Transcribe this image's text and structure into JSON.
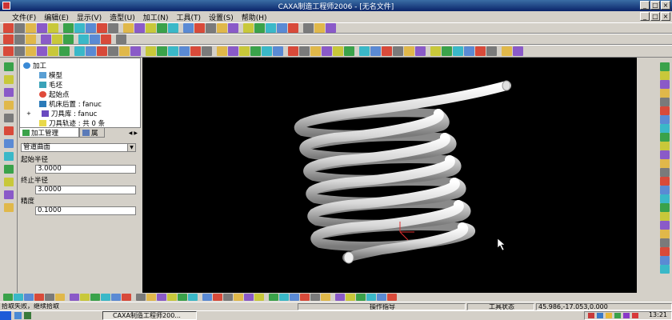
{
  "window": {
    "title": "CAXA制造工程师2006 - [无名文件]",
    "minimize": "_",
    "maximize": "□",
    "close": "×"
  },
  "menu": {
    "items": [
      "文件(F)",
      "编辑(E)",
      "显示(V)",
      "造型(U)",
      "加工(N)",
      "工具(T)",
      "设置(S)",
      "帮助(H)"
    ]
  },
  "tree": {
    "root": "加工",
    "nodes": [
      "模型",
      "毛坯",
      "起始点",
      "机床后置 : fanuc",
      "刀具库 : fanuc",
      "刀具轨迹 : 共 0 条"
    ],
    "expander": "+"
  },
  "tabs": {
    "machining": "加工管理",
    "attributes": "属"
  },
  "params": {
    "type_select": "管道曲面",
    "start_radius_label": "起始半径",
    "start_radius_value": "3.0000",
    "end_radius_label": "终止半径",
    "end_radius_value": "3.0000",
    "precision_label": "精度",
    "precision_value": "0.1000"
  },
  "status": {
    "message": "拾取失败，继续拾取",
    "operation_hint": "操作指导",
    "tool_state": "工具状态",
    "coordinates": "45.986,-17.053,0.000"
  },
  "taskbar": {
    "app_item": "CAXA制造工程师200...",
    "clock": "13:21"
  },
  "colors": {
    "title_start": "#3a6ea5",
    "title_end": "#0a246a",
    "viewport_bg": "#000000",
    "spring": "#e8e8e8"
  }
}
